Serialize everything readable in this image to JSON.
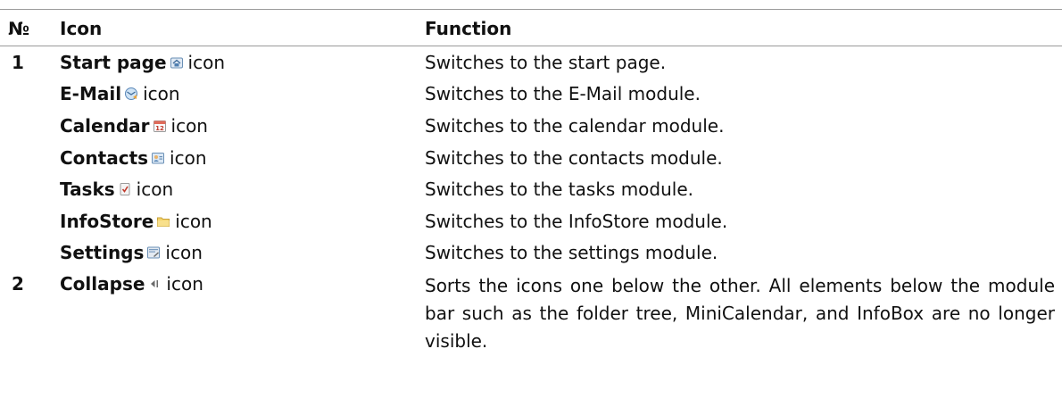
{
  "header": {
    "no": "№",
    "icon": "Icon",
    "function": "Function"
  },
  "rows": [
    {
      "no": "1",
      "name": "Start page",
      "suffix": "icon",
      "icon": "home-icon",
      "function": "Switches to the start page."
    },
    {
      "no": "",
      "name": "E-Mail",
      "suffix": "icon",
      "icon": "email-icon",
      "function": "Switches to the E-Mail module."
    },
    {
      "no": "",
      "name": "Calendar",
      "suffix": "icon",
      "icon": "calendar-icon",
      "function": "Switches to the calendar module."
    },
    {
      "no": "",
      "name": "Contacts",
      "suffix": "icon",
      "icon": "contacts-icon",
      "function": "Switches to the contacts module."
    },
    {
      "no": "",
      "name": "Tasks",
      "suffix": "icon",
      "icon": "tasks-icon",
      "function": "Switches to the tasks module."
    },
    {
      "no": "",
      "name": "InfoStore",
      "suffix": "icon",
      "icon": "folder-icon",
      "function": "Switches to the InfoStore module."
    },
    {
      "no": "",
      "name": "Settings",
      "suffix": "icon",
      "icon": "settings-icon",
      "function": "Switches to the settings module."
    },
    {
      "no": "2",
      "name": "Collapse",
      "suffix": "icon",
      "icon": "collapse-icon",
      "function": "Sorts the icons one below the other. All elements below the module bar such as the folder tree, MiniCalendar, and InfoBox are no longer visible."
    }
  ]
}
